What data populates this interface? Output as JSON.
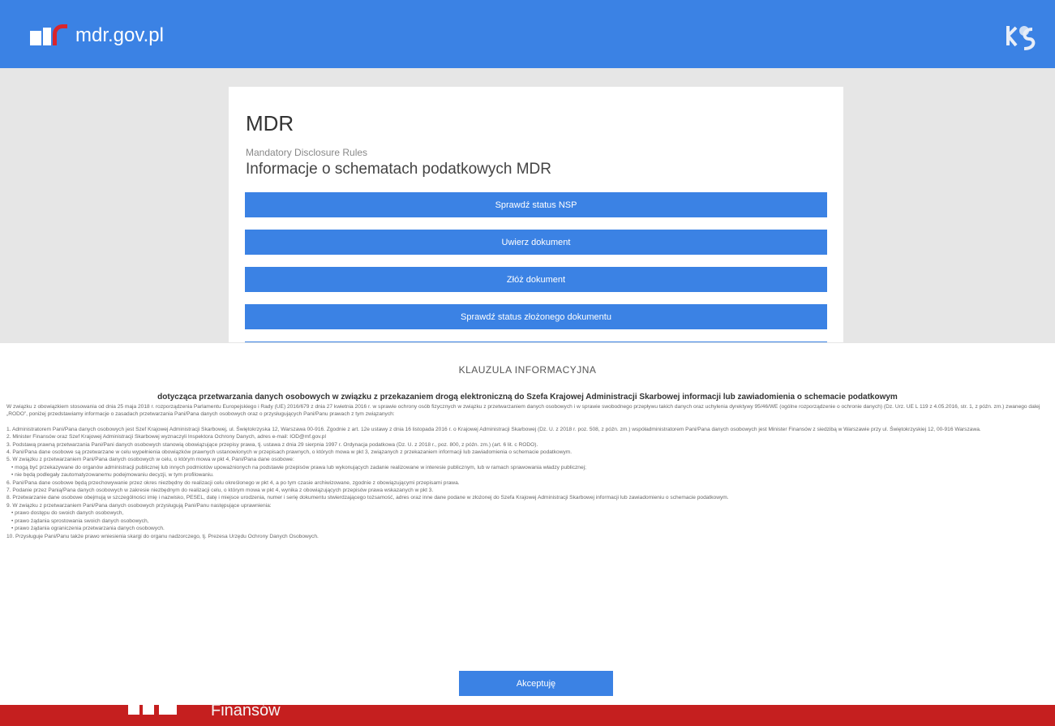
{
  "header": {
    "site_name": "mdr.gov.pl",
    "logo_icon": "ministry-logo",
    "right_icon": "kas-logo-icon",
    "brand_color": "#3b82e4"
  },
  "card": {
    "title": "MDR",
    "subtitle": "Mandatory Disclosure Rules",
    "heading": "Informacje o schematach podatkowych MDR",
    "buttons": [
      "Sprawdź status NSP",
      "Uwierz dokument",
      "Złóż dokument",
      "Sprawdź status złożonego dokumentu"
    ]
  },
  "modal": {
    "title": "KLAUZULA INFORMACYJNA",
    "subtitle": "dotycząca przetwarzania danych osobowych w związku z przekazaniem drogą elektroniczną do Szefa Krajowej Administracji Skarbowej informacji lub zawiadomienia o schemacie podatkowym",
    "intro": "W związku z obowiązkiem stosowania od dnia 25 maja 2018 r. rozporządzenia Parlamentu Europejskiego i Rady (UE) 2016/679 z dnia 27 kwietnia 2016 r. w sprawie ochrony osób fizycznych w związku z przetwarzaniem danych osobowych i w sprawie swobodnego przepływu takich danych oraz uchylenia dyrektywy 95/46/WE (ogólne rozporządzenie o ochronie danych) (Dz. Urz. UE L 119 z 4.05.2016, str. 1, z późn. zm.) zwanego dalej „RODO”, poniżej przedstawiamy informacje o zasadach przetwarzania Pani/Pana danych osobowych oraz o przysługujących Pani/Panu prawach z tym związanych:",
    "points": [
      "1. Administratorem Pani/Pana danych osobowych jest Szef Krajowej Administracji Skarbowej, ul. Świętokrzyska 12, Warszawa 00-916. Zgodnie z art. 12e ustawy z dnia 16 listopada 2016 r. o Krajowej Administracji Skarbowej (Dz. U. z 2018 r. poz. 508, z późn. zm.) współadministratorem Pani/Pana danych osobowych jest Minister Finansów z siedzibą w Warszawie przy ul. Świętokrzyskiej 12, 00-916 Warszawa.",
      "2. Minister Finansów oraz Szef Krajowej Administracji Skarbowej wyznaczyli Inspektora Ochrony Danych, adres e-mail: IOD@mf.gov.pl",
      "3. Podstawą prawną przetwarzania Pani/Pani danych osobowych stanowią obowiązujące przepisy prawa, tj. ustawa z dnia 29 sierpnia 1997 r. Ordynacja podatkowa (Dz. U. z 2018 r., poz. 800, z późn. zm.) (art. 6 lit. c RODO).",
      "4. Pani/Pana dane osobowe są przetwarzane w celu wypełnienia obowiązków prawnych ustanowionych w przepisach prawnych, o których mowa w pkt 3, związanych z przekazaniem informacji lub zawiadomienia o schemacie podatkowym.",
      "5. W związku z przetwarzaniem Pani/Pana danych osobowych w celu, o którym mowa w pkt 4, Pani/Pana dane osobowe:",
      "• mogą być przekazywane do organów administracji publicznej lub innych podmiotów upoważnionych na podstawie przepisów prawa lub wykonujących zadanie realizowane w interesie publicznym, lub w ramach sprawowania władzy publicznej;",
      "• nie będą podlegały zautomatyzowanemu podejmowaniu decyzji, w tym profilowaniu.",
      "6. Pani/Pana dane osobowe będą przechowywanie przez okres niezbędny do realizacji celu określonego w pkt 4, a po tym czasie archiwizowane, zgodnie z obowiązującymi przepisami prawa.",
      "7. Podanie przez Panią/Pana danych osobowych w zakresie niezbędnym do realizacji celu, o którym mowa w pkt 4, wynika z obowiązujących przepisów prawa wskazanych w pkt 3.",
      "8. Przetwarzanie dane osobowe obejmują w szczególności imię i nazwisko, PESEL, datę i miejsce urodzenia, numer i serię dokumentu stwierdzającego tożsamość, adres oraz inne dane podane w złożonej do Szefa Krajowej Administracji Skarbowej informacji lub zawiadomieniu o schemacie podatkowym.",
      "9. W związku z przetwarzaniem Pani/Pana danych osobowych przysługują Pani/Panu następujące uprawnienia:",
      "• prawo dostępu do swoich danych osobowych,",
      "• prawo żądania sprostowania swoich danych osobowych,",
      "• prawo żądania ograniczenia przetwarzania danych osobowych.",
      "10. Przysługuje Pani/Panu także prawo wniesienia skargi do organu nadzorczego, tj. Prezesa Urzędu Ochrony Danych Osobowych."
    ],
    "accept_label": "Akceptuję"
  },
  "footer": {
    "text": "Finansów",
    "color": "#c51f1f"
  }
}
